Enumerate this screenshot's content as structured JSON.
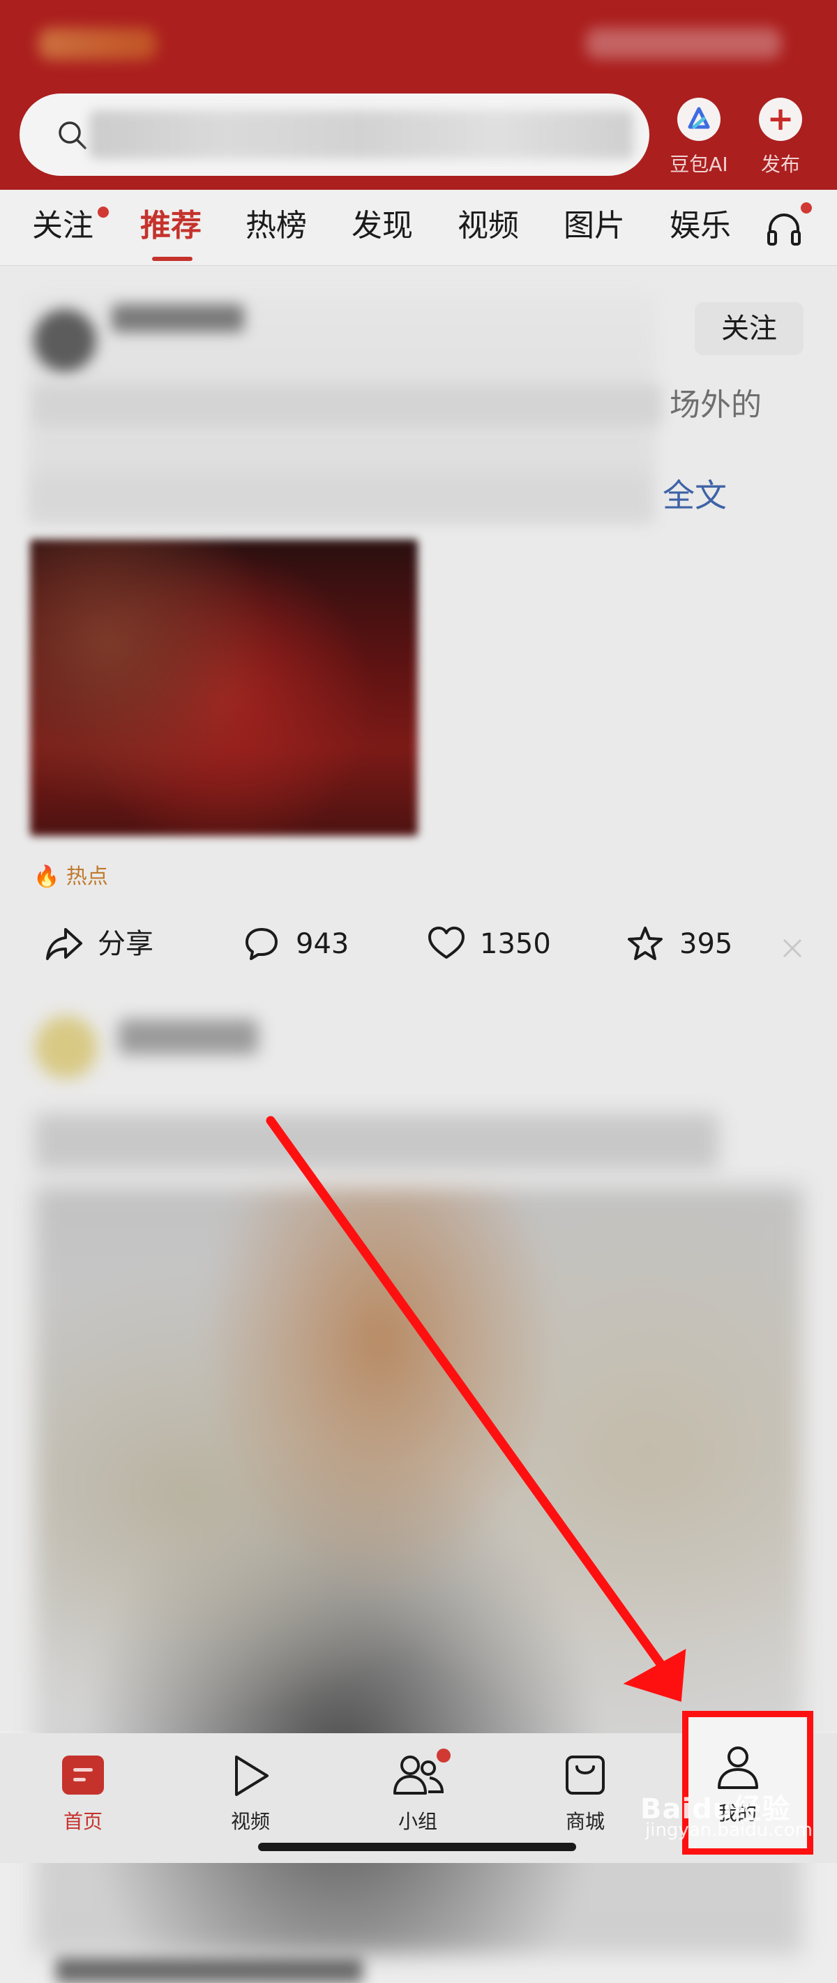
{
  "header": {
    "search": {
      "placeholder": ""
    },
    "doubao_label": "豆包AI",
    "publish_label": "发布"
  },
  "tabs": [
    {
      "label": "关注",
      "badge": true
    },
    {
      "label": "推荐",
      "active": true
    },
    {
      "label": "热榜"
    },
    {
      "label": "发现"
    },
    {
      "label": "视频"
    },
    {
      "label": "图片"
    },
    {
      "label": "娱乐"
    }
  ],
  "post": {
    "follow_label": "关注",
    "text_tail": "场外的",
    "read_more": "全文",
    "hot_tag": "热点",
    "actions": {
      "share": "分享",
      "comments": "943",
      "likes": "1350",
      "favorites": "395"
    }
  },
  "bottom_nav": [
    {
      "label": "首页",
      "icon": "home-icon",
      "active": true
    },
    {
      "label": "视频",
      "icon": "play-icon"
    },
    {
      "label": "小组",
      "icon": "group-icon",
      "badge": true
    },
    {
      "label": "商城",
      "icon": "bag-icon"
    },
    {
      "label": "我的",
      "icon": "person-icon"
    }
  ],
  "watermark": {
    "brand": "Baidu经验",
    "url": "jingyan.baidu.com"
  },
  "colors": {
    "brand_red": "#ab1f1e",
    "active_tab": "#c5322c",
    "annotation_red": "#ff1010"
  }
}
